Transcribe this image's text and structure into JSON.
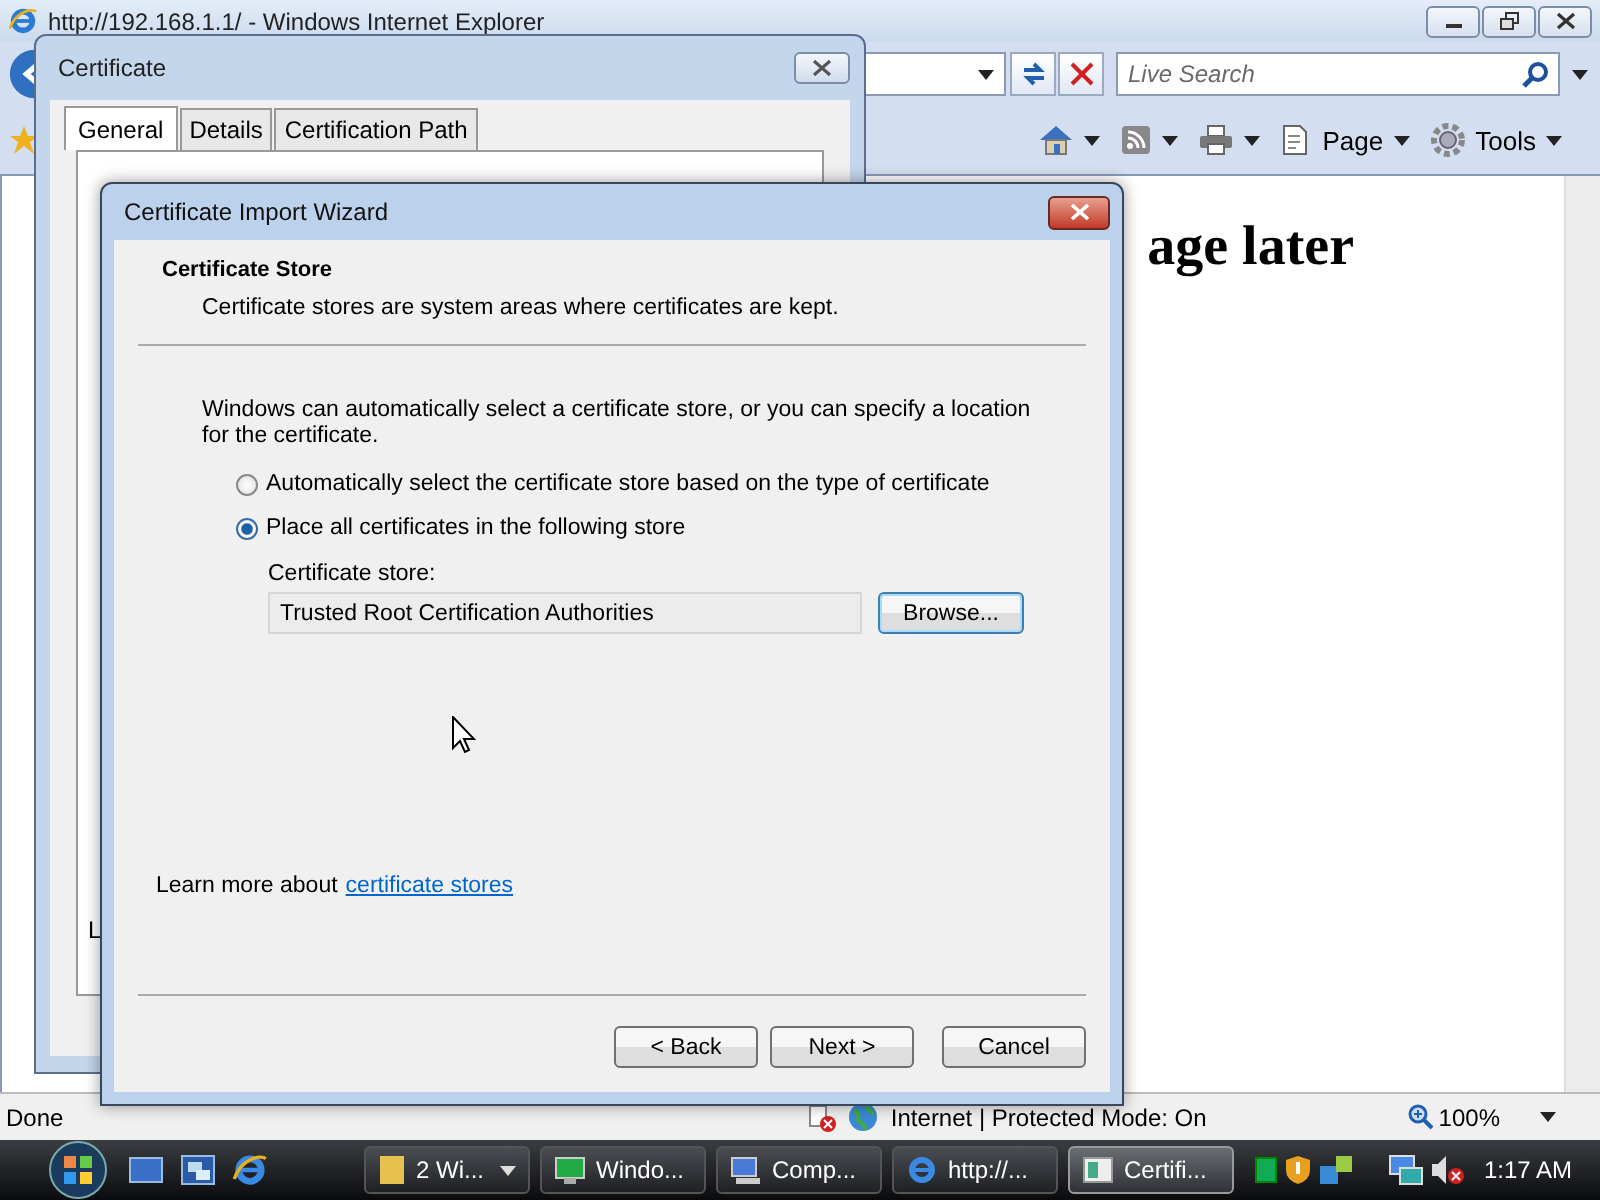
{
  "browser": {
    "title": "http://192.168.1.1/ - Windows Internet Explorer",
    "search": {
      "placeholder": "Live Search"
    },
    "toolbar": [
      {
        "kind": "home"
      },
      {
        "kind": "feeds"
      },
      {
        "kind": "print"
      },
      {
        "kind": "page",
        "label": "Page"
      },
      {
        "kind": "tools",
        "label": "Tools"
      }
    ],
    "page": {
      "heading": "age later"
    },
    "status_bar": {
      "status": "Done",
      "zone": "Internet | Protected Mode: On",
      "zoom": "100%"
    }
  },
  "certificate_dialog": {
    "title": "Certificate",
    "tabs": [
      {
        "label": "General",
        "selected": true
      },
      {
        "label": "Details",
        "selected": false
      },
      {
        "label": "Certification Path",
        "selected": false
      }
    ],
    "text_fragment": "L"
  },
  "wizard": {
    "title": "Certificate Import Wizard",
    "section_title": "Certificate Store",
    "section_description": "Certificate stores are system areas where certificates are kept.",
    "intro": "Windows can automatically select a certificate store, or you can specify a location for the certificate.",
    "options": [
      {
        "label": "Automatically select the certificate store based on the type of certificate",
        "selected": false
      },
      {
        "label": "Place all certificates in the following store",
        "selected": true
      }
    ],
    "store_label": "Certificate store:",
    "store_value": "Trusted Root Certification Authorities",
    "browse_button": "Browse...",
    "learn_more": "Learn more about",
    "learn_more_link": "certificate stores",
    "buttons": [
      {
        "label": "< Back"
      },
      {
        "label": "Next >"
      },
      {
        "label": "Cancel"
      }
    ]
  },
  "taskbar": {
    "items": [
      {
        "kind": "folder",
        "label": "2 Wi...",
        "selected": false,
        "grouped": true
      },
      {
        "kind": "monitor",
        "label": "Windo...",
        "selected": false,
        "grouped": false
      },
      {
        "kind": "computer",
        "label": "Comp...",
        "selected": false,
        "grouped": false
      },
      {
        "kind": "ie",
        "label": "http://...",
        "selected": false,
        "grouped": false
      },
      {
        "kind": "cert",
        "label": "Certifi...",
        "selected": true,
        "grouped": false
      }
    ],
    "clock": "1:17 AM"
  }
}
